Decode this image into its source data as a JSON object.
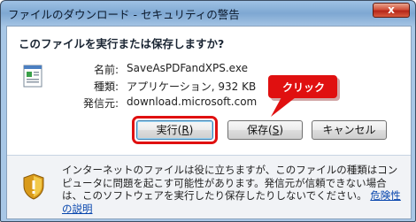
{
  "window": {
    "title": "ファイルのダウンロード - セキュリティの警告",
    "close_glyph": "x"
  },
  "question": "このファイルを実行または保存しますか?",
  "file": {
    "icon": "executable-file-icon",
    "name_label": "名前:",
    "name_value": "SaveAsPDFandXPS.exe",
    "type_label": "種類:",
    "type_value": "アプリケーション, 932 KB",
    "source_label": "発信元:",
    "source_value": "download.microsoft.com"
  },
  "buttons": {
    "run": {
      "prefix": "実行(",
      "key": "R",
      "suffix": ")"
    },
    "save": {
      "prefix": "保存(",
      "key": "S",
      "suffix": ")"
    },
    "cancel": "キャンセル"
  },
  "annotation": {
    "text": "クリック",
    "color": "#e01010"
  },
  "warning": {
    "icon": "security-shield-icon",
    "text": "インターネットのファイルは役に立ちますが、このファイルの種類はコンピュータに問題を起こす可能性があります。発信元が信頼できない場合は、このソフトウェアを実行したり保存したりしないでください。",
    "link": "危険性の説明"
  }
}
